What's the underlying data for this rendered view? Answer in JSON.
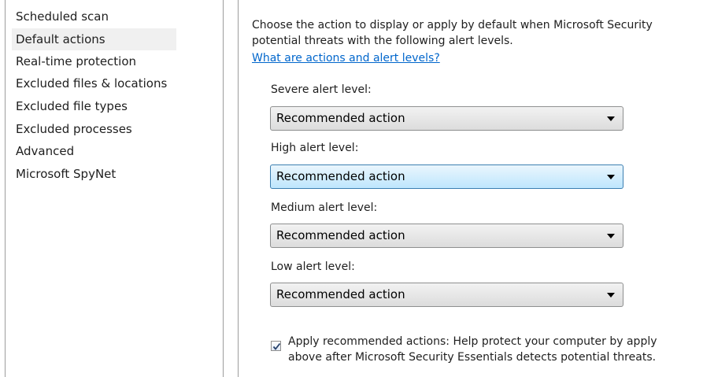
{
  "sidebar": {
    "items": [
      {
        "label": "Scheduled scan"
      },
      {
        "label": "Default actions"
      },
      {
        "label": "Real-time protection"
      },
      {
        "label": "Excluded files & locations"
      },
      {
        "label": "Excluded file types"
      },
      {
        "label": "Excluded processes"
      },
      {
        "label": "Advanced"
      },
      {
        "label": "Microsoft SpyNet"
      }
    ],
    "selected": "Default actions"
  },
  "content": {
    "intro_line1": "Choose the action to display or apply by default when Microsoft Security",
    "intro_line2": "potential threats with the following alert levels.",
    "help_link": "What are actions and alert levels?",
    "levels": [
      {
        "label": "Severe alert level:",
        "value": "Recommended action"
      },
      {
        "label": "High alert level:",
        "value": "Recommended action",
        "focused": true
      },
      {
        "label": "Medium alert level:",
        "value": "Recommended action"
      },
      {
        "label": "Low alert level:",
        "value": "Recommended action"
      }
    ],
    "apply_checkbox": {
      "checked": true,
      "label_line1": "Apply recommended actions: Help protect your computer by apply",
      "label_line2": "above after Microsoft Security Essentials detects potential threats."
    }
  },
  "colors": {
    "link": "#0066cc",
    "focus_border": "#3c7fb1",
    "selected_bg": "#f0f0f0"
  }
}
